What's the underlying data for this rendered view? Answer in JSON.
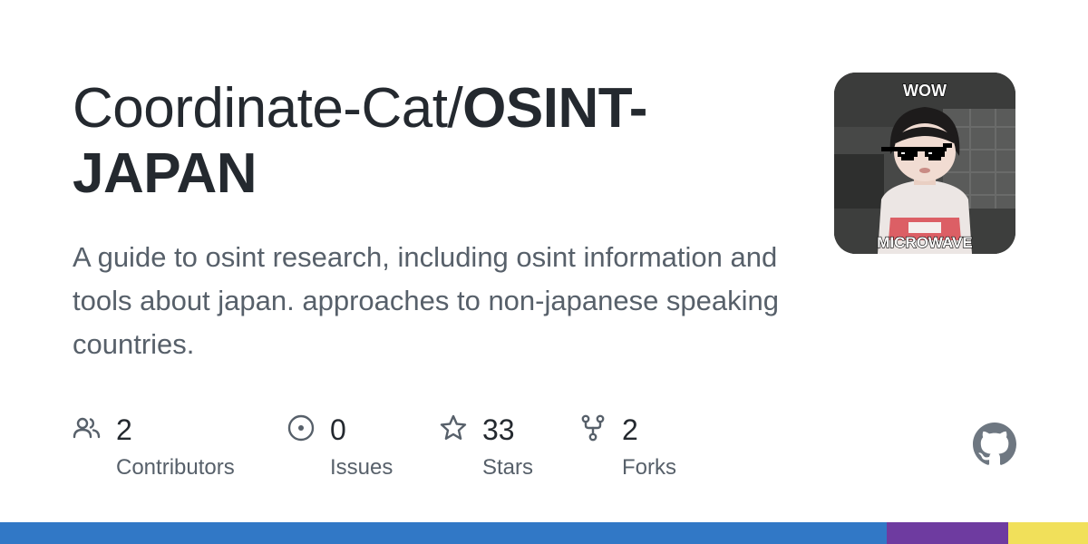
{
  "repo": {
    "owner_prefix": "Coordinate-Cat/",
    "name": "OSINT-JAPAN",
    "description": "A guide to osint research, including osint information and tools about japan. approaches to non-japanese speaking countries."
  },
  "avatar": {
    "top_text": "WOW",
    "bottom_text": "MICROWAVE"
  },
  "stats": [
    {
      "icon": "people-icon",
      "value": "2",
      "label": "Contributors"
    },
    {
      "icon": "issue-circle-icon",
      "value": "0",
      "label": "Issues"
    },
    {
      "icon": "star-icon",
      "value": "33",
      "label": "Stars"
    },
    {
      "icon": "fork-icon",
      "value": "2",
      "label": "Forks"
    }
  ],
  "brand_icon": "github-mark-icon",
  "colors": {
    "title": "#24292f",
    "muted": "#57606a",
    "icon": "#57606a",
    "github_logo": "#6e7781"
  },
  "languages": [
    {
      "share": 0.815,
      "color": "#3178c6"
    },
    {
      "share": 0.112,
      "color": "#6e3ba0"
    },
    {
      "share": 0.073,
      "color": "#f1e05a"
    }
  ]
}
